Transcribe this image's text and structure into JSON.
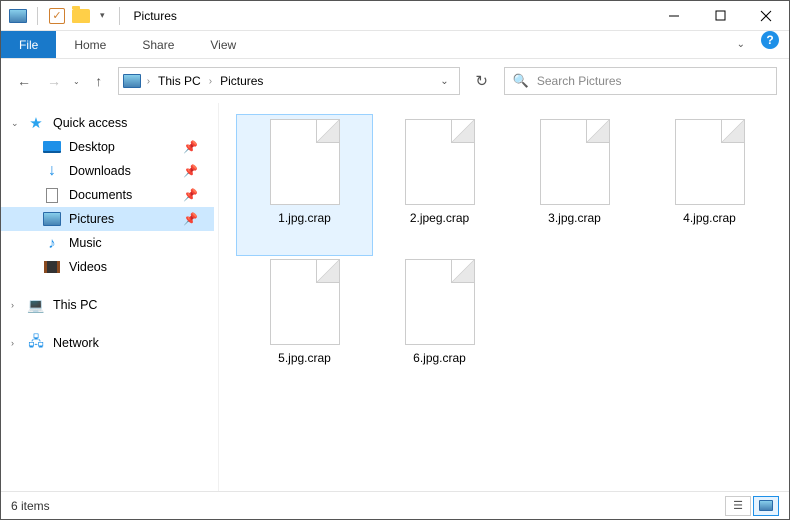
{
  "window": {
    "title": "Pictures"
  },
  "ribbon": {
    "file": "File",
    "home": "Home",
    "share": "Share",
    "view": "View"
  },
  "breadcrumb": {
    "pc": "This PC",
    "folder": "Pictures"
  },
  "search": {
    "placeholder": "Search Pictures"
  },
  "sidebar": {
    "quick_access": "Quick access",
    "desktop": "Desktop",
    "downloads": "Downloads",
    "documents": "Documents",
    "pictures": "Pictures",
    "music": "Music",
    "videos": "Videos",
    "this_pc": "This PC",
    "network": "Network"
  },
  "files": [
    {
      "name": "1.jpg.crap"
    },
    {
      "name": "2.jpeg.crap"
    },
    {
      "name": "3.jpg.crap"
    },
    {
      "name": "4.jpg.crap"
    },
    {
      "name": "5.jpg.crap"
    },
    {
      "name": "6.jpg.crap"
    }
  ],
  "status": {
    "count": "6 items"
  }
}
